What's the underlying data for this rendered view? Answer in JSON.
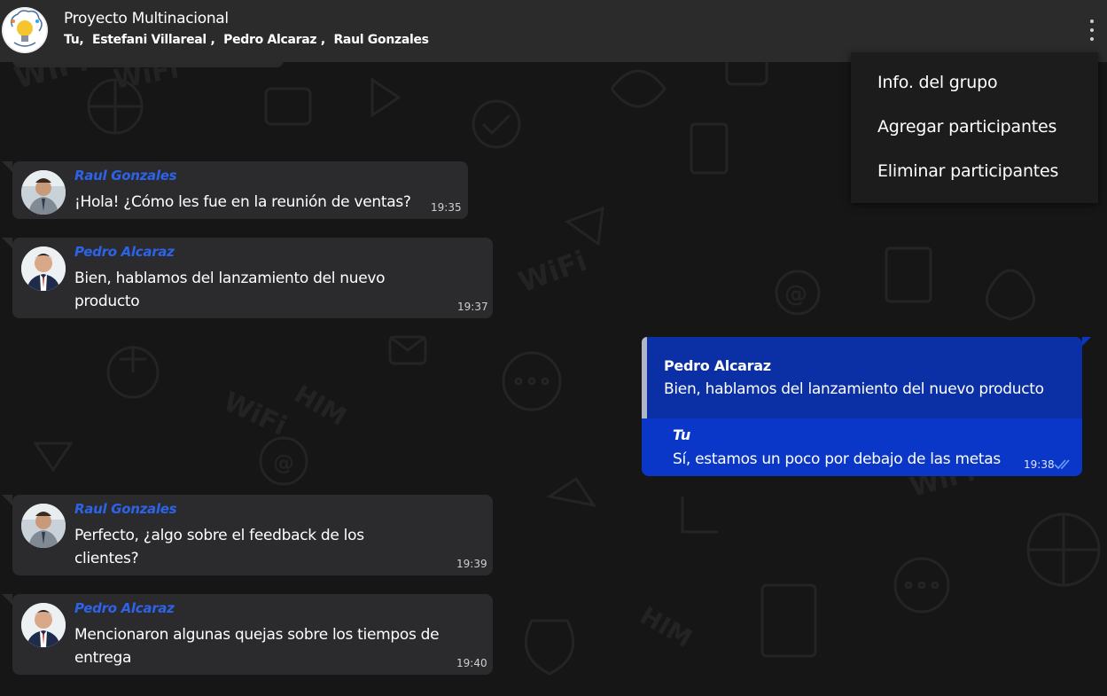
{
  "header": {
    "title": "Proyecto Multinacional",
    "participants": [
      "Tu,",
      "Estefani Villareal ,",
      "Pedro Alcaraz ,",
      "Raul Gonzales"
    ],
    "menu_icon": "more-vertical-icon"
  },
  "menu": {
    "items": [
      "Info. del grupo",
      "Agregar participantes",
      "Eliminar participantes"
    ]
  },
  "messages": [
    {
      "sender": "Raul Gonzales",
      "text": "¡Hola! ¿Cómo les fue en la reunión de ventas?",
      "time": "19:35"
    },
    {
      "sender": "Pedro Alcaraz",
      "text": "Bien, hablamos del lanzamiento del nuevo producto",
      "time": "19:37"
    },
    {
      "sender": "Raul Gonzales",
      "text": "Perfecto, ¿algo sobre el feedback de los clientes?",
      "time": "19:39"
    },
    {
      "sender": "Pedro Alcaraz",
      "text": "Mencionaron algunas quejas sobre los tiempos de entrega",
      "time": "19:40"
    }
  ],
  "own_message": {
    "quoted_sender": "Pedro Alcaraz",
    "quoted_text": "Bien, hablamos del lanzamiento del nuevo producto",
    "sender": "Tu",
    "text": "Sí, estamos un poco por debajo de las metas",
    "time": "19:38",
    "status_icon": "double-check-icon"
  },
  "colors": {
    "header_bg": "#2b2b2b",
    "incoming_bubble": "#2b2b2d",
    "outgoing_bubble": "#0a37c8",
    "sender_name": "#2c63e8"
  }
}
